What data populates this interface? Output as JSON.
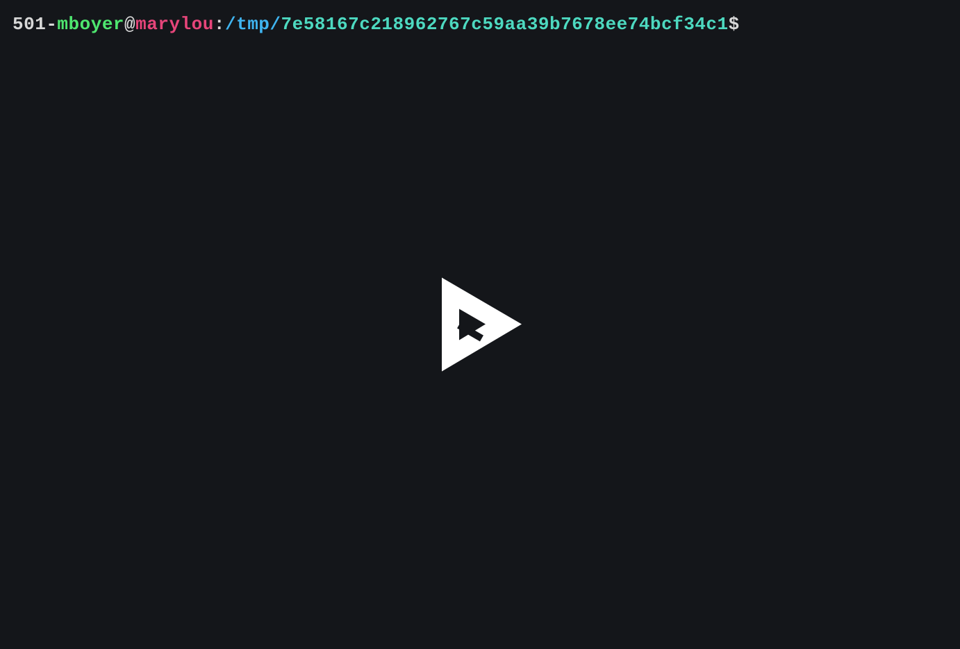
{
  "prompt": {
    "number": "501",
    "dash": "-",
    "user": "mboyer",
    "at": "@",
    "host": "marylou",
    "colon": ":",
    "path_prefix": "/tmp/",
    "path_hash": "7e58167c218962767c59aa39b7678ee74bcf34c1",
    "dollar": "$"
  }
}
